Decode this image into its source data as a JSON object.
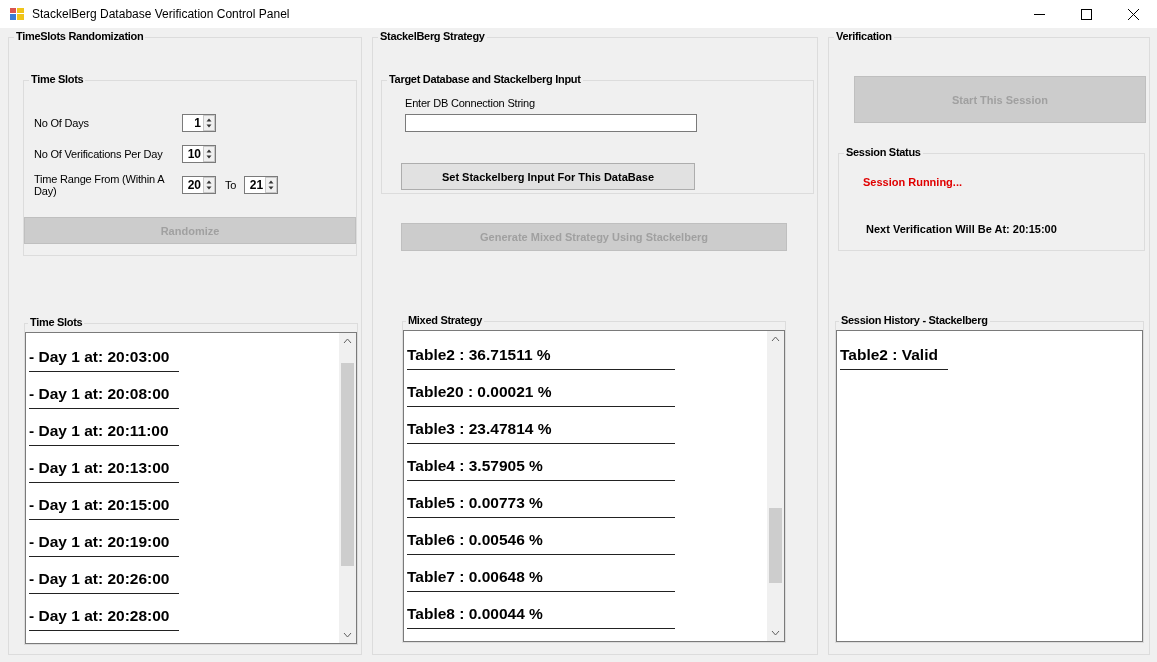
{
  "window": {
    "title": "StackelBerg Database Verification Control Panel"
  },
  "timeslots_randomization": {
    "title": "TimeSlots Randomization",
    "group": {
      "title": "Time Slots",
      "fields": [
        {
          "label": "No Of Days",
          "value": "1"
        },
        {
          "label": "No Of Verifications Per Day",
          "value": "10"
        },
        {
          "label": "Time Range From (Within A Day)",
          "value": "20",
          "to_label": "To",
          "to_value": "21"
        }
      ]
    },
    "button": {
      "label": "Randomize",
      "disabled": true
    },
    "list": {
      "title": "Time Slots",
      "items": [
        "- Day 1 at: 20:03:00",
        "- Day 1 at: 20:08:00",
        "- Day 1 at: 20:11:00",
        "- Day 1 at: 20:13:00",
        "- Day 1 at: 20:15:00",
        "- Day 1 at: 20:19:00",
        "- Day 1 at: 20:26:00",
        "- Day 1 at: 20:28:00"
      ]
    }
  },
  "stackelberg_strategy": {
    "title": "StackelBerg Strategy",
    "group": {
      "title": "Target Database and Stackelberg Input",
      "field_label": "Enter DB Connection String",
      "button": {
        "label": "Set Stackelberg Input For This DataBase",
        "disabled": false
      }
    },
    "button": {
      "label": "Generate Mixed Strategy Using Stackelberg",
      "disabled": true
    },
    "list": {
      "title": "Mixed Strategy",
      "items": [
        "Table2 : 36.71511 %",
        "Table20 : 0.00021 %",
        "Table3 : 23.47814 %",
        "Table4 : 3.57905 %",
        "Table5 : 0.00773 %",
        "Table6 : 0.00546 %",
        "Table7 : 0.00648 %",
        "Table8 : 0.00044 %"
      ]
    }
  },
  "verification": {
    "title": "Verification",
    "button": {
      "label": "Start This Session",
      "disabled": true
    },
    "status": {
      "title": "Session Status",
      "state": "Session Running...",
      "next": "Next Verification Will Be At: 20:15:00"
    },
    "list": {
      "title": "Session History - Stackelberg",
      "items": [
        "Table2 : Valid"
      ]
    }
  }
}
